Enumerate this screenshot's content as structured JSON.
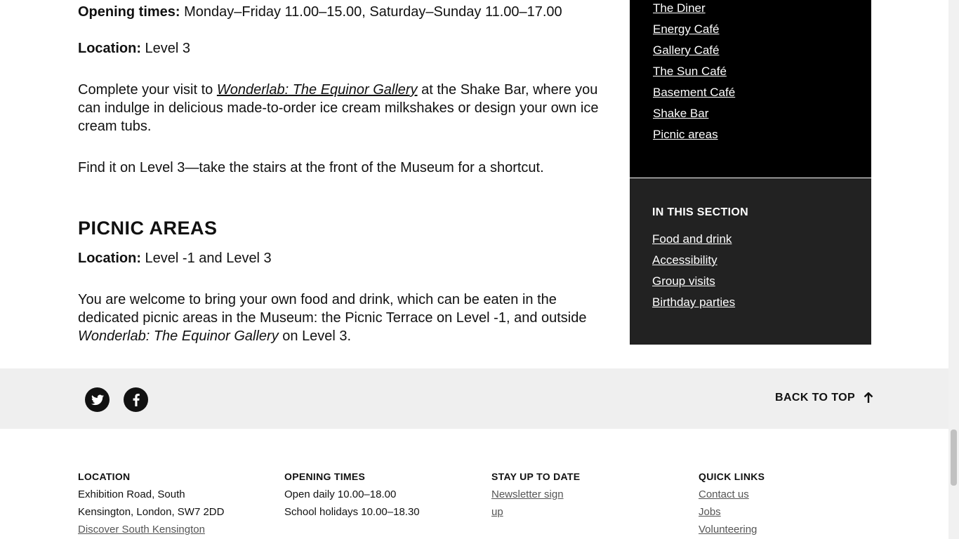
{
  "main": {
    "opening_label": "Opening times:",
    "opening_value": " Monday–Friday 11.00–15.00, Saturday–Sunday 11.00–17.00",
    "location_label": "Location:",
    "location_value": " Level 3",
    "shake_p1_before": "Complete your visit to ",
    "shake_p1_link": "Wonderlab: The Equinor Gallery",
    "shake_p1_after": " at the Shake Bar, where you can indulge in delicious made-to-order ice cream milkshakes or design your own ice cream tubs.",
    "shake_p2": "Find it on Level 3—take the stairs at the front of the Museum for a shortcut.",
    "picnic_heading": "PICNIC AREAS",
    "picnic_location_label": "Location:",
    "picnic_location_value": " Level -1 and Level 3",
    "picnic_p_before": "You are welcome to bring your own food and drink, which can be eaten in the dedicated picnic areas in the Museum: the Picnic Terrace on Level -1, and outside ",
    "picnic_p_em": "Wonderlab: The Equinor Gallery",
    "picnic_p_after": " on Level 3."
  },
  "sidebar_links": [
    "The Diner",
    "Energy Café",
    "Gallery Café",
    "The Sun Café",
    "Basement Café",
    "Shake Bar",
    "Picnic areas"
  ],
  "section": {
    "title": "IN THIS SECTION",
    "links": [
      "Food and drink",
      "Accessibility",
      "Group visits",
      "Birthday parties"
    ]
  },
  "social": {
    "twitter_icon": "twitter-icon",
    "facebook_icon": "facebook-icon",
    "back_to_top": "BACK TO TOP"
  },
  "footer": {
    "location": {
      "title": "LOCATION",
      "line1": "Exhibition Road, South",
      "line2": "Kensington, London, SW7 2DD",
      "link": "Discover South Kensington"
    },
    "opening": {
      "title": "OPENING TIMES",
      "line1": "Open daily 10.00–18.00",
      "line2": "School holidays 10.00–18.30"
    },
    "stay": {
      "title": "STAY UP TO DATE",
      "link_line1": "Newsletter sign",
      "link_line2": "up"
    },
    "quick": {
      "title": "QUICK LINKS",
      "links": [
        "Contact us",
        "Jobs",
        "Volunteering"
      ]
    }
  }
}
